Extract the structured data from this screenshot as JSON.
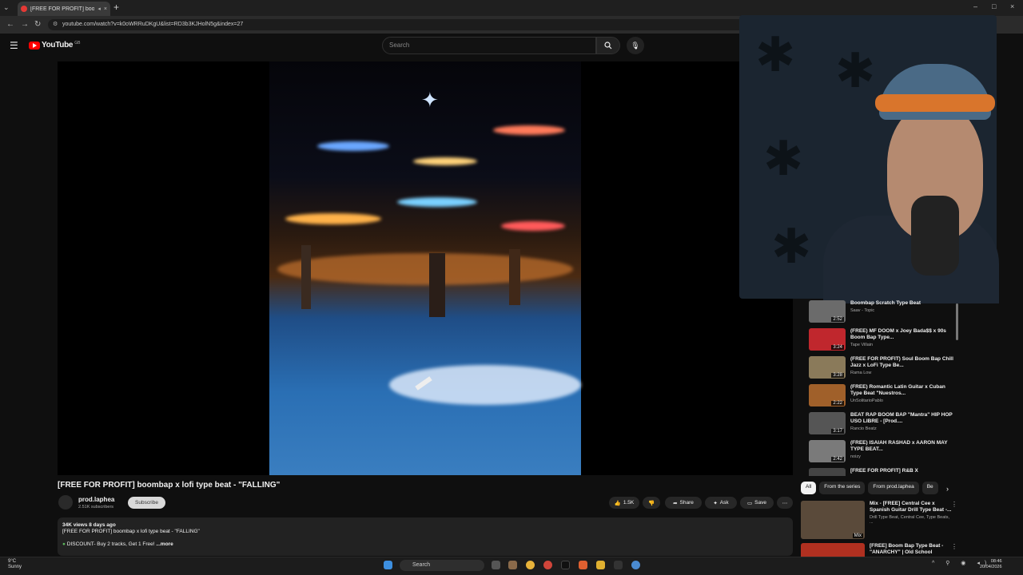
{
  "browser": {
    "tab_title": "[FREE FOR PROFIT] boombap",
    "url": "youtube.com/watch?v=k0oWRRuDKgU&list=RD3b3KJHolN5g&index=27"
  },
  "header": {
    "logo_text": "YouTube",
    "logo_country": "GB",
    "search_placeholder": "Search"
  },
  "video": {
    "title": "[FREE FOR PROFIT] boombap x lofi type beat - \"FALLING\"",
    "channel": "prod.laphea",
    "subscribers": "2.51K subscribers",
    "subscribe_label": "Subscribe",
    "likes": "1.5K",
    "share_label": "Share",
    "ask_label": "Ask",
    "save_label": "Save",
    "views_age": "34K views  8 days ago",
    "desc_line": "[FREE FOR PROFIT] boombap x lofi type beat - \"FALLING\"",
    "desc_discount": "DISCOUNT- Buy 2 tracks, Get 1 Free!",
    "more_label": "...more"
  },
  "playlist": [
    {
      "title": "Boombap Scratch Type Beat",
      "channel": "Saav - Topic",
      "duration": "2:52",
      "color": "#6b6b6b"
    },
    {
      "title": "(FREE) MF DOOM x Joey Bada$$ x 90s Boom Bap Type...",
      "channel": "Tape Villain",
      "duration": "3:24",
      "color": "#c0272d"
    },
    {
      "title": "(FREE FOR PROFIT) Soul Boom Bap Chill Jazz x LoFi Type Be...",
      "channel": "Rama Low",
      "duration": "3:28",
      "color": "#8a7a5a"
    },
    {
      "title": "(FREE) Romantic Latin Guitar x Cuban Type Beat \"Nuestros...",
      "channel": "UnSolitarioPablo",
      "duration": "2:22",
      "color": "#a0602a"
    },
    {
      "title": "BEAT RAP BOOM BAP \"Mantra\" HIP HOP USO LIBRE - [Prod....",
      "channel": "Rancio Beatz",
      "duration": "3:17",
      "color": "#555"
    },
    {
      "title": "(FREE) ISAIAH RASHAD x AARON MAY TYPE BEAT...",
      "channel": "noizy",
      "duration": "2:42",
      "color": "#7a7a7a"
    },
    {
      "title": "[FREE FOR PROFIT] R&B X",
      "channel": "",
      "duration": "",
      "color": "#444"
    }
  ],
  "chips": [
    "All",
    "From the series",
    "From prod.laphea",
    "Be"
  ],
  "recommendations": [
    {
      "title": "Mix - [FREE] Central Cee x Spanish Guitar Drill Type Beat -...",
      "sub": "Drill Type Beat, Central Cee, Type Beats, ...",
      "badge": "Mix",
      "color": "#5a4a3a"
    },
    {
      "title": "[FREE] Boom Bap Type Beat - \"ANARCHY\" | Old School",
      "sub": "",
      "badge": "",
      "color": "#b03020"
    }
  ],
  "taskbar": {
    "weather_temp": "9°C",
    "weather_desc": "Sunny",
    "search_label": "Search",
    "time": "08:46",
    "date": "20/04/2026"
  }
}
